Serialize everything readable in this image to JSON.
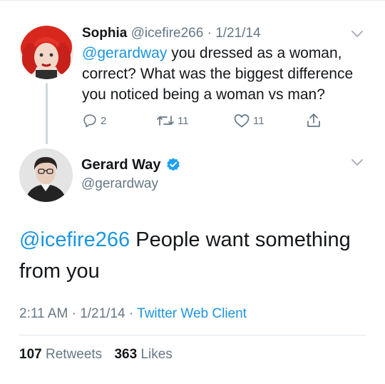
{
  "reply_context_tweet": {
    "name": "Sophia",
    "handle": "@icefire266",
    "separator": "·",
    "date": "1/21/14",
    "mention": "@gerardway",
    "text": " you dressed as a woman, correct? What was the biggest difference you noticed being a woman vs man?",
    "actions": {
      "reply_count": "2",
      "retweet_count": "11",
      "like_count": "11"
    },
    "icons": [
      "reply-icon",
      "retweet-icon",
      "like-icon",
      "share-icon",
      "chevron-down-icon"
    ]
  },
  "main_tweet": {
    "name": "Gerard Way",
    "handle": "@gerardway",
    "verified": true,
    "mention": "@icefire266",
    "text": " People want something from you",
    "time": "2:11 AM",
    "separator": "·",
    "date": "1/21/14",
    "client": "Twitter Web Client",
    "retweets_count": "107",
    "retweets_label": "Retweets",
    "likes_count": "363",
    "likes_label": "Likes"
  },
  "colors": {
    "link": "#1b95e0",
    "secondary_text": "#657786",
    "primary_text": "#14171a",
    "verified_badge": "#1da1f2"
  }
}
